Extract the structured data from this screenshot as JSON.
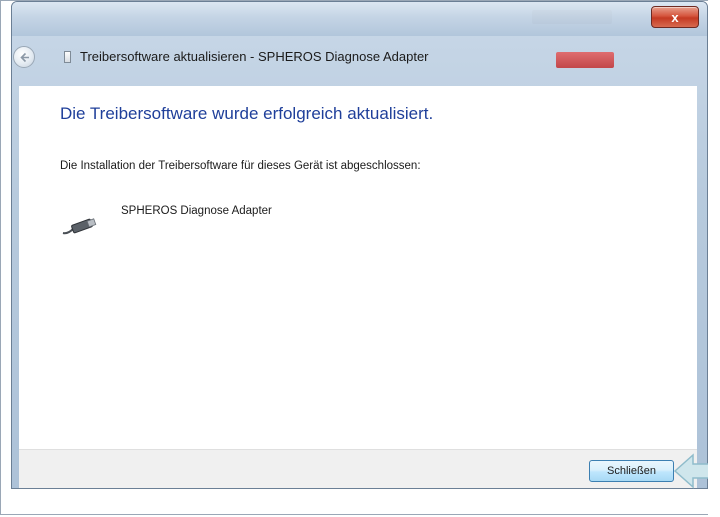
{
  "window": {
    "title": "Treibersoftware aktualisieren - SPHEROS Diagnose Adapter",
    "close_label": "x"
  },
  "content": {
    "headline": "Die Treibersoftware wurde erfolgreich aktualisiert.",
    "description": "Die Installation der Treibersoftware für dieses Gerät ist abgeschlossen:",
    "device_name": "SPHEROS Diagnose Adapter"
  },
  "footer": {
    "close_button_label": "Schließen"
  },
  "colors": {
    "headline": "#1f3f9a",
    "arrow": "#9fcbd6"
  },
  "icons": {
    "back": "back-arrow-icon",
    "device": "usb-cable-icon",
    "pointer": "arrow-left-icon"
  }
}
